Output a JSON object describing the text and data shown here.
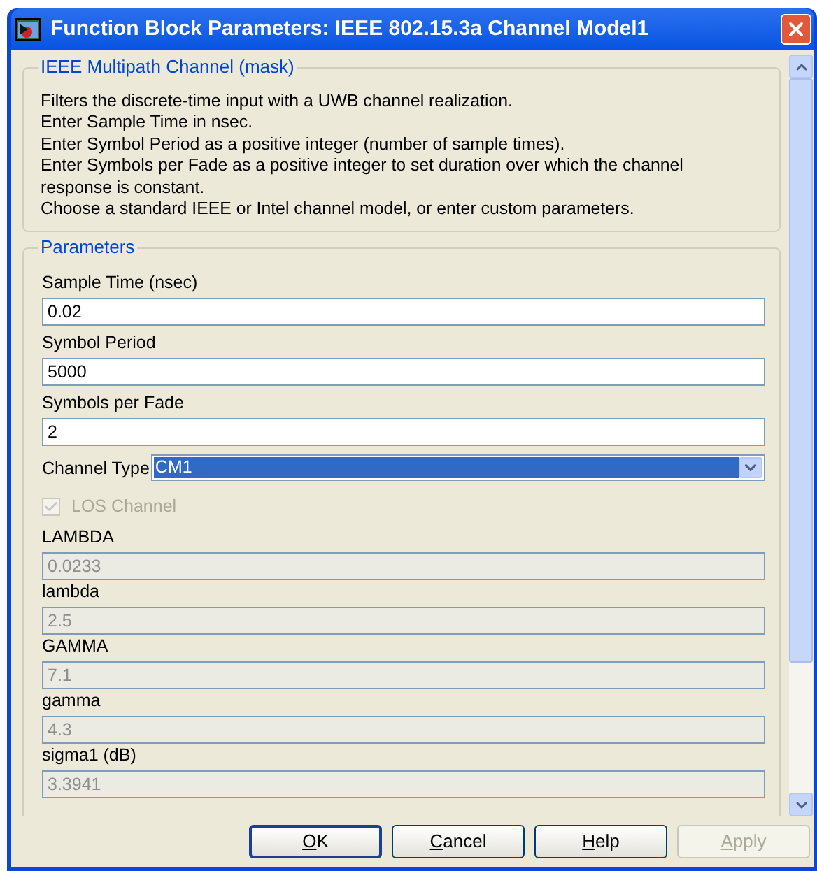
{
  "window": {
    "title": "Function Block Parameters: IEEE 802.15.3a Channel Model1"
  },
  "description": {
    "title": "IEEE Multipath Channel (mask)",
    "lines": [
      "Filters the discrete-time input with a UWB channel realization.",
      "Enter Sample Time in nsec.",
      "Enter Symbol Period as a positive integer (number of sample times).",
      "Enter Symbols per Fade as a positive integer to set duration over which the channel",
      "response is constant.",
      "Choose a standard IEEE or Intel channel model, or enter custom parameters."
    ]
  },
  "parameters": {
    "title": "Parameters",
    "fields": [
      {
        "kind": "text",
        "label": "Sample Time (nsec)",
        "value": "0.02",
        "disabled": false
      },
      {
        "kind": "text",
        "label": "Symbol Period",
        "value": "5000",
        "disabled": false
      },
      {
        "kind": "text",
        "label": "Symbols per Fade",
        "value": "2",
        "disabled": false
      },
      {
        "kind": "select",
        "label": "Channel Type",
        "value": "CM1",
        "focused": true
      },
      {
        "kind": "checkbox",
        "label": "LOS Channel",
        "checked": true,
        "disabled": true
      },
      {
        "kind": "text",
        "label": "LAMBDA",
        "value": "0.0233",
        "disabled": true
      },
      {
        "kind": "text",
        "label": "lambda",
        "value": "2.5",
        "disabled": true
      },
      {
        "kind": "text",
        "label": "GAMMA",
        "value": "7.1",
        "disabled": true
      },
      {
        "kind": "text",
        "label": "gamma",
        "value": "4.3",
        "disabled": true
      },
      {
        "kind": "text",
        "label": "sigma1 (dB)",
        "value": "3.3941",
        "disabled": true
      }
    ]
  },
  "buttons": [
    {
      "mnemonic": "O",
      "rest": "K",
      "default": true,
      "disabled": false
    },
    {
      "mnemonic": "C",
      "rest": "ancel",
      "default": false,
      "disabled": false
    },
    {
      "mnemonic": "H",
      "rest": "elp",
      "default": false,
      "disabled": false
    },
    {
      "mnemonic": "A",
      "rest": "pply",
      "default": false,
      "disabled": true
    }
  ]
}
